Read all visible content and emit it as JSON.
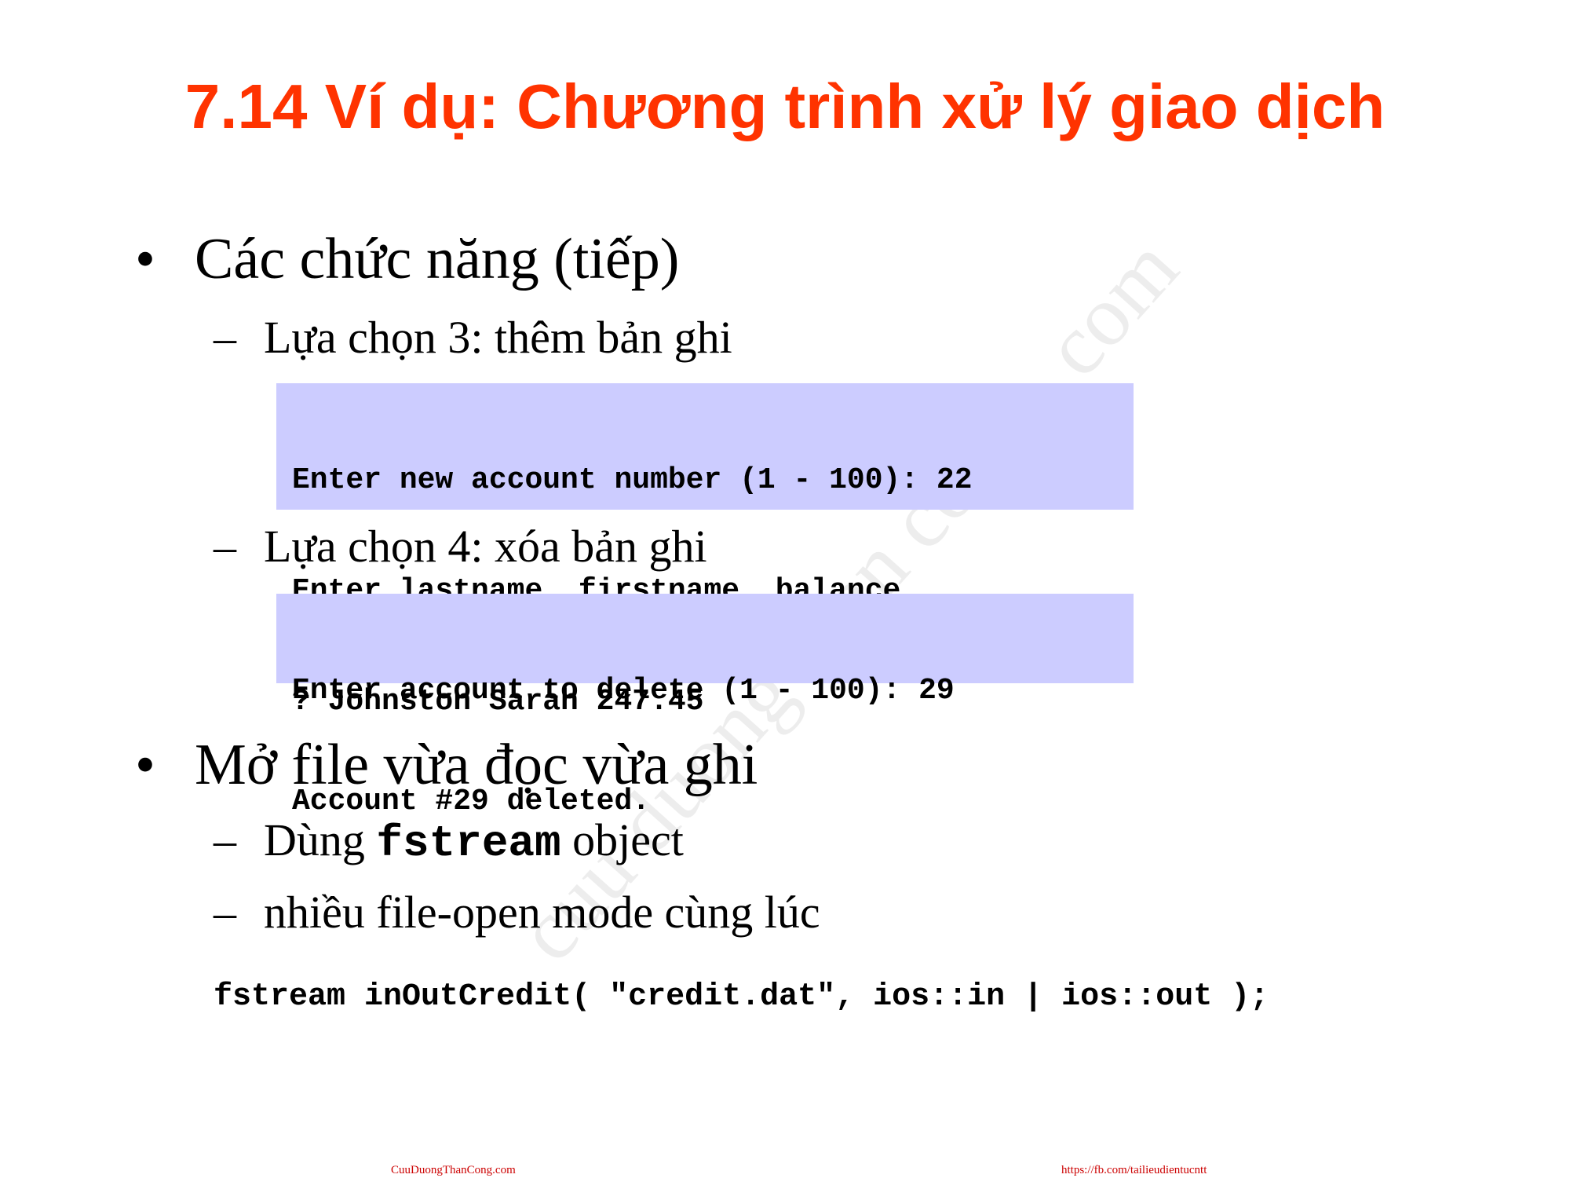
{
  "title": "7.14  Ví dụ: Chương trình xử lý giao dịch",
  "bullets": [
    {
      "marker": "•",
      "text": "Các chức năng (tiếp)",
      "items": [
        {
          "marker": "–",
          "text": "Lựa chọn 3: thêm bản ghi",
          "code": [
            "Enter new account number (1 - 100): 22",
            "Enter lastname, firstname, balance",
            "? Johnston Sarah 247.45"
          ]
        },
        {
          "marker": "–",
          "text": "Lựa chọn 4: xóa bản ghi",
          "code": [
            "Enter account to delete (1 - 100): 29",
            "Account #29 deleted."
          ]
        }
      ]
    },
    {
      "marker": "•",
      "text": "Mở file vừa đọc vừa ghi",
      "items": [
        {
          "marker": "–",
          "prefix": "Dùng ",
          "code_word": "fstream",
          "suffix": " object"
        },
        {
          "marker": "–",
          "text": "nhiều file-open mode cùng lúc"
        }
      ]
    }
  ],
  "code_line": "fstream inOutCredit( \"credit.dat\", ios::in | ios::out );",
  "watermark": "cuu duong than cong . com",
  "footer": {
    "left": "CuuDuongThanCong.com",
    "right": "https://fb.com/tailieudientucntt"
  }
}
